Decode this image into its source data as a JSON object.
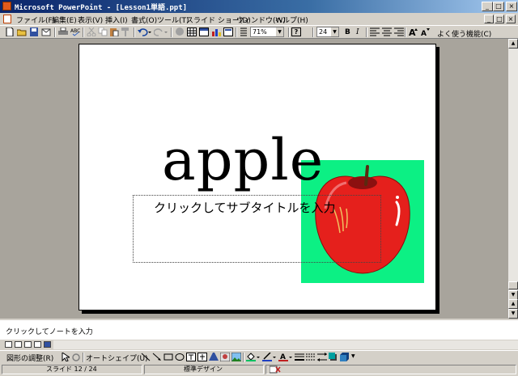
{
  "window": {
    "title": "Microsoft PowerPoint - [Lesson1単語.ppt]",
    "minimize": "_",
    "maximize": "□",
    "close": "×"
  },
  "menu": {
    "items": [
      "ファイル(F)",
      "編集(E)",
      "表示(V)",
      "挿入(I)",
      "書式(O)",
      "ツール(T)",
      "スライド ショー(D)",
      "ウィンドウ(W)",
      "ヘルプ(H)"
    ],
    "doc_buttons": [
      "_",
      "□",
      "×"
    ]
  },
  "toolbar": {
    "zoom": "71%",
    "font_size": "24",
    "bold": "B",
    "italic": "I",
    "tasks": "よく使う機能(C)",
    "help": "?"
  },
  "slide": {
    "title": "apple",
    "subtitle_placeholder": "クリックしてサブタイトルを入力"
  },
  "notes": {
    "placeholder": "クリックしてノートを入力"
  },
  "drawing_toolbar": {
    "draw_menu": "図形の調整(R)",
    "autoshapes": "オートシェイプ(U)"
  },
  "status": {
    "slide_pos": "スライド 12  /  24",
    "design": "標準デザイン"
  },
  "colors": {
    "title_bar": "#0a246a",
    "apple_bg": "#0cf084",
    "apple": "#e5201c"
  }
}
